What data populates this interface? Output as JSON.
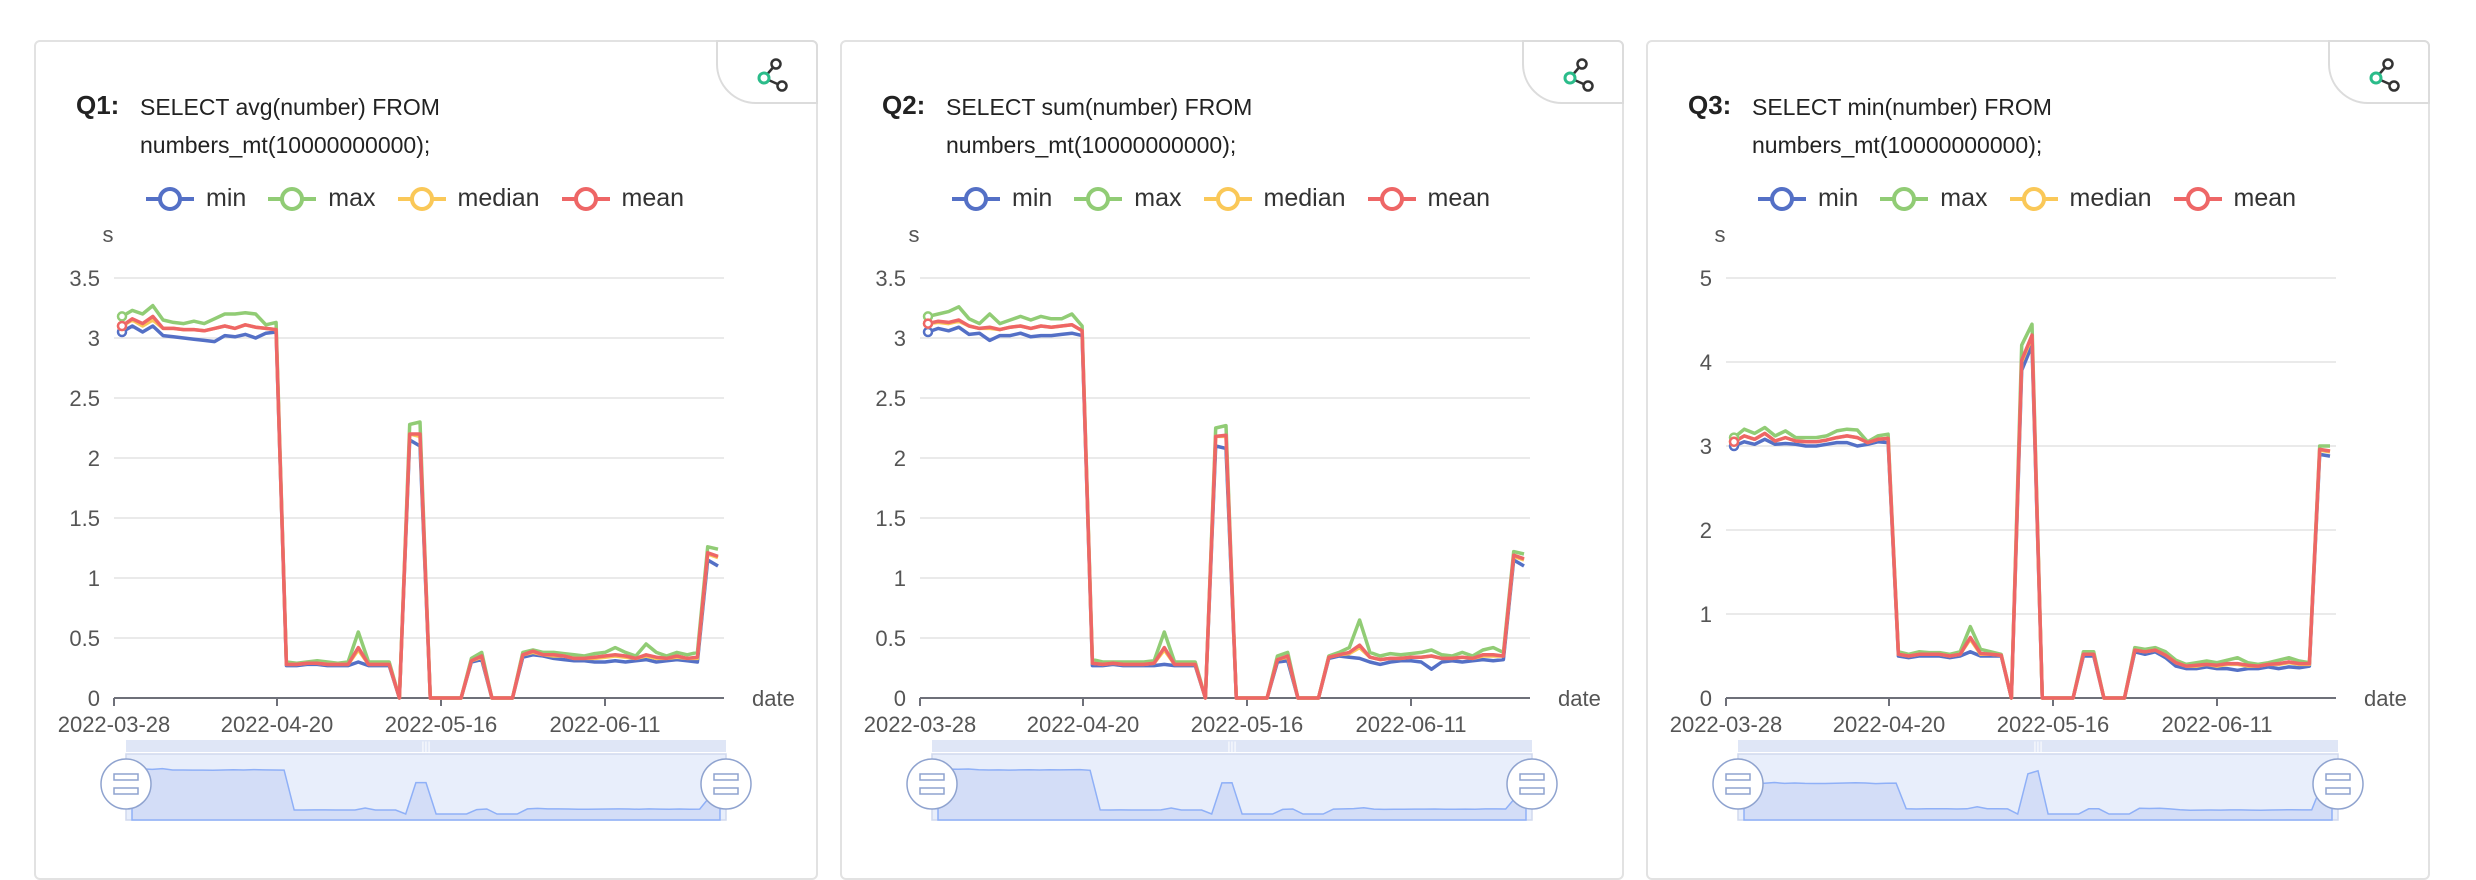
{
  "colors": {
    "min": "#5470c6",
    "max": "#91cc75",
    "median": "#fac858",
    "mean": "#ee6666",
    "grid": "#e3e3e3",
    "axis": "#6e7079",
    "slider_fill": "#d3ddf7",
    "slider_line": "#8fb0f7"
  },
  "charts": [
    {
      "label": "Q1:",
      "query": "SELECT avg(number) FROM\nnumbers_mt(10000000000);"
    },
    {
      "label": "Q2:",
      "query": "SELECT sum(number) FROM\nnumbers_mt(10000000000);"
    },
    {
      "label": "Q3:",
      "query": "SELECT min(number) FROM\nnumbers_mt(10000000000);"
    }
  ],
  "legend": [
    "min",
    "max",
    "median",
    "mean"
  ],
  "chart_data": [
    {
      "type": "line",
      "title": "Q1: SELECT avg(number) FROM numbers_mt(10000000000);",
      "xlabel": "date",
      "ylabel": "s",
      "x_ticks": [
        "2022-03-28",
        "2022-04-20",
        "2022-05-16",
        "2022-06-11"
      ],
      "y_ticks": [
        "0",
        "0.5",
        "1",
        "1.5",
        "2",
        "2.5",
        "3",
        "3.5"
      ],
      "ylim": [
        0,
        3.5
      ],
      "series": [
        {
          "name": "min",
          "values": [
            3.05,
            3.1,
            3.05,
            3.1,
            3.02,
            3.01,
            3.0,
            2.99,
            2.98,
            2.97,
            3.02,
            3.01,
            3.03,
            3.0,
            3.04,
            3.05,
            0.27,
            0.27,
            0.28,
            0.28,
            0.27,
            0.27,
            0.27,
            0.3,
            0.27,
            0.27,
            0.27,
            0.0,
            2.15,
            2.1,
            0.0,
            0.0,
            0.0,
            0.0,
            0.3,
            0.32,
            0.0,
            0.0,
            0.0,
            0.34,
            0.36,
            0.35,
            0.33,
            0.32,
            0.31,
            0.31,
            0.3,
            0.3,
            0.31,
            0.3,
            0.31,
            0.32,
            0.3,
            0.31,
            0.32,
            0.31,
            0.3,
            1.15,
            1.1
          ]
        },
        {
          "name": "max",
          "values": [
            3.18,
            3.23,
            3.2,
            3.27,
            3.15,
            3.13,
            3.12,
            3.14,
            3.12,
            3.16,
            3.2,
            3.2,
            3.21,
            3.2,
            3.11,
            3.13,
            0.3,
            0.29,
            0.3,
            0.31,
            0.3,
            0.29,
            0.3,
            0.55,
            0.3,
            0.3,
            0.3,
            0.0,
            2.28,
            2.3,
            0.0,
            0.0,
            0.0,
            0.0,
            0.33,
            0.38,
            0.0,
            0.0,
            0.0,
            0.38,
            0.4,
            0.38,
            0.38,
            0.37,
            0.36,
            0.35,
            0.37,
            0.38,
            0.42,
            0.38,
            0.35,
            0.45,
            0.38,
            0.35,
            0.38,
            0.36,
            0.38,
            1.26,
            1.24
          ]
        },
        {
          "name": "median",
          "values": [
            3.1,
            3.15,
            3.1,
            3.15,
            3.08,
            3.08,
            3.07,
            3.07,
            3.06,
            3.08,
            3.1,
            3.08,
            3.11,
            3.09,
            3.08,
            3.07,
            0.28,
            0.28,
            0.29,
            0.29,
            0.28,
            0.28,
            0.28,
            0.4,
            0.28,
            0.28,
            0.28,
            0.0,
            2.2,
            2.18,
            0.0,
            0.0,
            0.0,
            0.0,
            0.31,
            0.34,
            0.0,
            0.0,
            0.0,
            0.36,
            0.38,
            0.36,
            0.35,
            0.35,
            0.33,
            0.33,
            0.33,
            0.34,
            0.35,
            0.34,
            0.33,
            0.35,
            0.33,
            0.33,
            0.34,
            0.33,
            0.33,
            1.2,
            1.17
          ]
        },
        {
          "name": "mean",
          "values": [
            3.1,
            3.16,
            3.12,
            3.18,
            3.08,
            3.08,
            3.07,
            3.07,
            3.06,
            3.08,
            3.1,
            3.08,
            3.11,
            3.09,
            3.08,
            3.07,
            0.28,
            0.28,
            0.29,
            0.29,
            0.28,
            0.28,
            0.28,
            0.42,
            0.28,
            0.28,
            0.28,
            0.0,
            2.2,
            2.2,
            0.0,
            0.0,
            0.0,
            0.0,
            0.31,
            0.35,
            0.0,
            0.0,
            0.0,
            0.36,
            0.39,
            0.36,
            0.36,
            0.35,
            0.33,
            0.33,
            0.34,
            0.35,
            0.36,
            0.35,
            0.33,
            0.36,
            0.34,
            0.33,
            0.35,
            0.33,
            0.34,
            1.21,
            1.18
          ]
        }
      ]
    },
    {
      "type": "line",
      "title": "Q2: SELECT sum(number) FROM numbers_mt(10000000000);",
      "xlabel": "date",
      "ylabel": "s",
      "x_ticks": [
        "2022-03-28",
        "2022-04-20",
        "2022-05-16",
        "2022-06-11"
      ],
      "y_ticks": [
        "0",
        "0.5",
        "1",
        "1.5",
        "2",
        "2.5",
        "3",
        "3.5"
      ],
      "ylim": [
        0,
        3.5
      ],
      "series": [
        {
          "name": "min",
          "values": [
            3.05,
            3.08,
            3.06,
            3.09,
            3.03,
            3.04,
            2.98,
            3.02,
            3.02,
            3.04,
            3.01,
            3.02,
            3.02,
            3.03,
            3.04,
            3.02,
            0.27,
            0.27,
            0.28,
            0.27,
            0.27,
            0.27,
            0.27,
            0.28,
            0.27,
            0.27,
            0.27,
            0.0,
            2.1,
            2.08,
            0.0,
            0.0,
            0.0,
            0.0,
            0.3,
            0.31,
            0.0,
            0.0,
            0.0,
            0.33,
            0.35,
            0.34,
            0.33,
            0.3,
            0.28,
            0.3,
            0.31,
            0.31,
            0.3,
            0.24,
            0.3,
            0.31,
            0.3,
            0.31,
            0.32,
            0.31,
            0.32,
            1.15,
            1.1
          ]
        },
        {
          "name": "max",
          "values": [
            3.18,
            3.2,
            3.22,
            3.26,
            3.16,
            3.12,
            3.2,
            3.12,
            3.15,
            3.18,
            3.15,
            3.18,
            3.16,
            3.16,
            3.2,
            3.1,
            0.32,
            0.3,
            0.3,
            0.3,
            0.3,
            0.3,
            0.31,
            0.55,
            0.3,
            0.3,
            0.3,
            0.0,
            2.25,
            2.27,
            0.0,
            0.0,
            0.0,
            0.0,
            0.35,
            0.38,
            0.0,
            0.0,
            0.0,
            0.35,
            0.38,
            0.42,
            0.65,
            0.38,
            0.35,
            0.37,
            0.36,
            0.37,
            0.38,
            0.4,
            0.36,
            0.35,
            0.38,
            0.35,
            0.4,
            0.42,
            0.38,
            1.22,
            1.2
          ]
        },
        {
          "name": "median",
          "values": [
            3.12,
            3.13,
            3.12,
            3.14,
            3.1,
            3.08,
            3.08,
            3.07,
            3.09,
            3.1,
            3.08,
            3.1,
            3.09,
            3.1,
            3.11,
            3.06,
            0.29,
            0.28,
            0.29,
            0.28,
            0.28,
            0.28,
            0.29,
            0.4,
            0.28,
            0.28,
            0.28,
            0.0,
            2.18,
            2.18,
            0.0,
            0.0,
            0.0,
            0.0,
            0.32,
            0.34,
            0.0,
            0.0,
            0.0,
            0.34,
            0.36,
            0.37,
            0.42,
            0.34,
            0.32,
            0.33,
            0.33,
            0.34,
            0.34,
            0.35,
            0.33,
            0.33,
            0.34,
            0.33,
            0.35,
            0.35,
            0.35,
            1.18,
            1.15
          ]
        },
        {
          "name": "mean",
          "values": [
            3.12,
            3.14,
            3.13,
            3.15,
            3.1,
            3.08,
            3.09,
            3.07,
            3.09,
            3.1,
            3.08,
            3.1,
            3.09,
            3.1,
            3.11,
            3.06,
            0.29,
            0.28,
            0.29,
            0.28,
            0.28,
            0.28,
            0.29,
            0.42,
            0.28,
            0.28,
            0.28,
            0.0,
            2.18,
            2.19,
            0.0,
            0.0,
            0.0,
            0.0,
            0.32,
            0.35,
            0.0,
            0.0,
            0.0,
            0.34,
            0.36,
            0.38,
            0.44,
            0.34,
            0.32,
            0.33,
            0.33,
            0.34,
            0.34,
            0.35,
            0.33,
            0.33,
            0.34,
            0.33,
            0.36,
            0.36,
            0.35,
            1.19,
            1.16
          ]
        }
      ]
    },
    {
      "type": "line",
      "title": "Q3: SELECT min(number) FROM numbers_mt(10000000000);",
      "xlabel": "date",
      "ylabel": "s",
      "x_ticks": [
        "2022-03-28",
        "2022-04-20",
        "2022-05-16",
        "2022-06-11"
      ],
      "y_ticks": [
        "0",
        "1",
        "2",
        "3",
        "4",
        "5"
      ],
      "ylim": [
        0,
        5
      ],
      "series": [
        {
          "name": "min",
          "values": [
            3.0,
            3.05,
            3.02,
            3.08,
            3.02,
            3.03,
            3.02,
            3.0,
            3.0,
            3.02,
            3.04,
            3.04,
            3.0,
            3.02,
            3.05,
            3.04,
            0.5,
            0.48,
            0.5,
            0.5,
            0.5,
            0.48,
            0.5,
            0.55,
            0.5,
            0.5,
            0.5,
            0.0,
            3.9,
            4.2,
            0.0,
            0.0,
            0.0,
            0.0,
            0.5,
            0.5,
            0.0,
            0.0,
            0.0,
            0.55,
            0.52,
            0.55,
            0.48,
            0.38,
            0.35,
            0.35,
            0.37,
            0.35,
            0.35,
            0.33,
            0.35,
            0.35,
            0.37,
            0.35,
            0.37,
            0.36,
            0.38,
            2.9,
            2.88
          ]
        },
        {
          "name": "max",
          "values": [
            3.1,
            3.2,
            3.15,
            3.22,
            3.12,
            3.18,
            3.1,
            3.1,
            3.1,
            3.12,
            3.18,
            3.2,
            3.19,
            3.05,
            3.12,
            3.14,
            0.55,
            0.52,
            0.55,
            0.54,
            0.54,
            0.52,
            0.55,
            0.85,
            0.58,
            0.55,
            0.52,
            0.0,
            4.2,
            4.45,
            0.0,
            0.0,
            0.0,
            0.0,
            0.55,
            0.55,
            0.0,
            0.0,
            0.0,
            0.6,
            0.58,
            0.6,
            0.55,
            0.45,
            0.4,
            0.42,
            0.44,
            0.42,
            0.45,
            0.48,
            0.42,
            0.4,
            0.42,
            0.45,
            0.48,
            0.44,
            0.42,
            3.0,
            3.0
          ]
        },
        {
          "name": "median",
          "values": [
            3.05,
            3.12,
            3.08,
            3.15,
            3.06,
            3.1,
            3.06,
            3.05,
            3.05,
            3.07,
            3.1,
            3.12,
            3.1,
            3.04,
            3.08,
            3.09,
            0.52,
            0.5,
            0.52,
            0.52,
            0.52,
            0.5,
            0.52,
            0.7,
            0.52,
            0.52,
            0.51,
            0.0,
            4.0,
            4.3,
            0.0,
            0.0,
            0.0,
            0.0,
            0.52,
            0.52,
            0.0,
            0.0,
            0.0,
            0.57,
            0.55,
            0.57,
            0.51,
            0.42,
            0.38,
            0.38,
            0.4,
            0.38,
            0.4,
            0.4,
            0.38,
            0.38,
            0.4,
            0.4,
            0.42,
            0.4,
            0.4,
            2.95,
            2.93
          ]
        },
        {
          "name": "mean",
          "values": [
            3.05,
            3.12,
            3.08,
            3.15,
            3.06,
            3.1,
            3.06,
            3.05,
            3.05,
            3.07,
            3.1,
            3.12,
            3.1,
            3.04,
            3.08,
            3.09,
            0.52,
            0.5,
            0.52,
            0.52,
            0.52,
            0.5,
            0.52,
            0.72,
            0.53,
            0.52,
            0.51,
            0.0,
            4.02,
            4.32,
            0.0,
            0.0,
            0.0,
            0.0,
            0.52,
            0.52,
            0.0,
            0.0,
            0.0,
            0.57,
            0.55,
            0.57,
            0.51,
            0.42,
            0.38,
            0.39,
            0.4,
            0.39,
            0.41,
            0.41,
            0.39,
            0.38,
            0.4,
            0.41,
            0.43,
            0.41,
            0.41,
            2.96,
            2.94
          ]
        }
      ]
    }
  ]
}
